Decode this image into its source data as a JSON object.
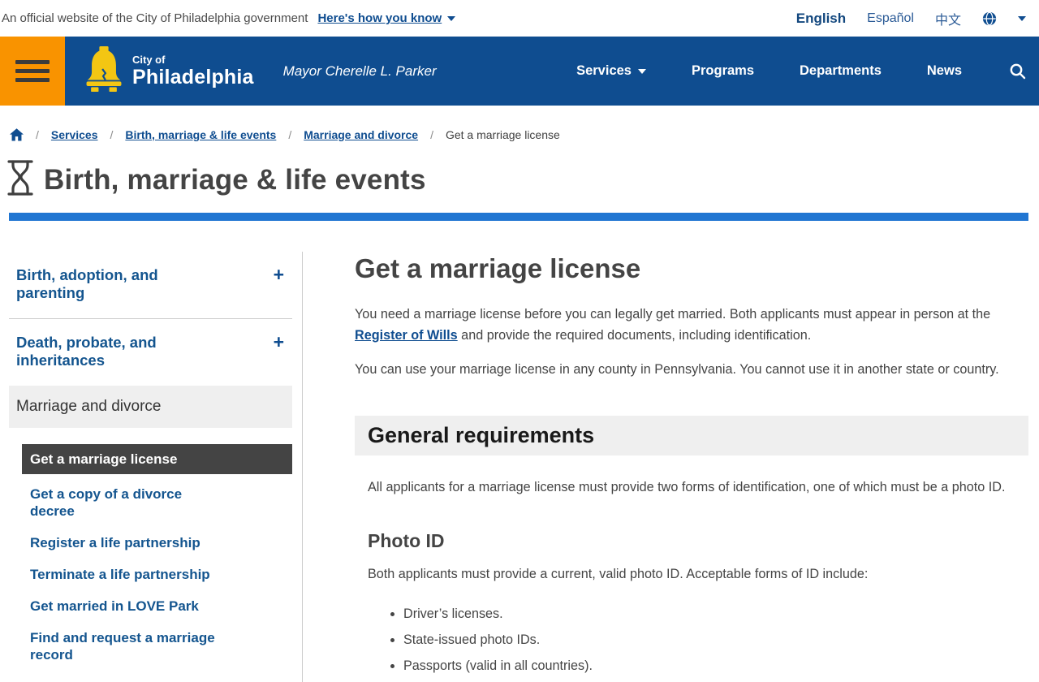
{
  "topbar": {
    "official_text": "An official website of the City of Philadelphia government",
    "how_you_know": "Here's how you know",
    "languages": [
      "English",
      "Español",
      "中文"
    ]
  },
  "header": {
    "logo_line1": "City of",
    "logo_line2": "Philadelphia",
    "mayor": "Mayor Cherelle L. Parker",
    "nav": [
      "Services",
      "Programs",
      "Departments",
      "News"
    ]
  },
  "breadcrumb": {
    "separator": "/",
    "items": [
      {
        "label": "Services"
      },
      {
        "label": "Birth, marriage & life events"
      },
      {
        "label": "Marriage and divorce"
      },
      {
        "label": "Get a marriage license"
      }
    ]
  },
  "page": {
    "title": "Birth, marriage & life events"
  },
  "sidebar": {
    "accordions": [
      {
        "label": "Birth, adoption, and parenting",
        "expander": "+"
      },
      {
        "label": "Death, probate, and inheritances",
        "expander": "+"
      }
    ],
    "active_section": "Marriage and divorce",
    "links": [
      {
        "label": "Get a marriage license",
        "selected": true
      },
      {
        "label": "Get a copy of a divorce decree"
      },
      {
        "label": "Register a life partnership"
      },
      {
        "label": "Terminate a life partnership"
      },
      {
        "label": "Get married in LOVE Park"
      },
      {
        "label": "Find and request a marriage record"
      }
    ]
  },
  "main": {
    "title": "Get a marriage license",
    "intro_p1_before": "You need a marriage license before you can legally get married. Both applicants must appear in person at the ",
    "intro_link": "Register of Wills",
    "intro_p1_after": " and provide the required documents, including identification.",
    "intro_p2": "You can use your marriage license in any county in Pennsylvania. You cannot use it in another state or country.",
    "section": {
      "heading": "General requirements",
      "p1": "All applicants for a marriage license must provide two forms of identification, one of which must be a photo ID.",
      "sub_heading": "Photo ID",
      "p2": "Both applicants must provide a current, valid photo ID. Acceptable forms of ID include:",
      "bullets": [
        "Driver’s licenses.",
        "State-issued photo IDs.",
        "Passports (valid in all countries)."
      ]
    }
  },
  "colors": {
    "header_navy": "#0f4d90",
    "accent_orange": "#f99300",
    "bar_blue": "#2176d2",
    "bell_yellow": "#f3c613",
    "selected_dark": "#444444",
    "band_gray": "#efefef"
  }
}
